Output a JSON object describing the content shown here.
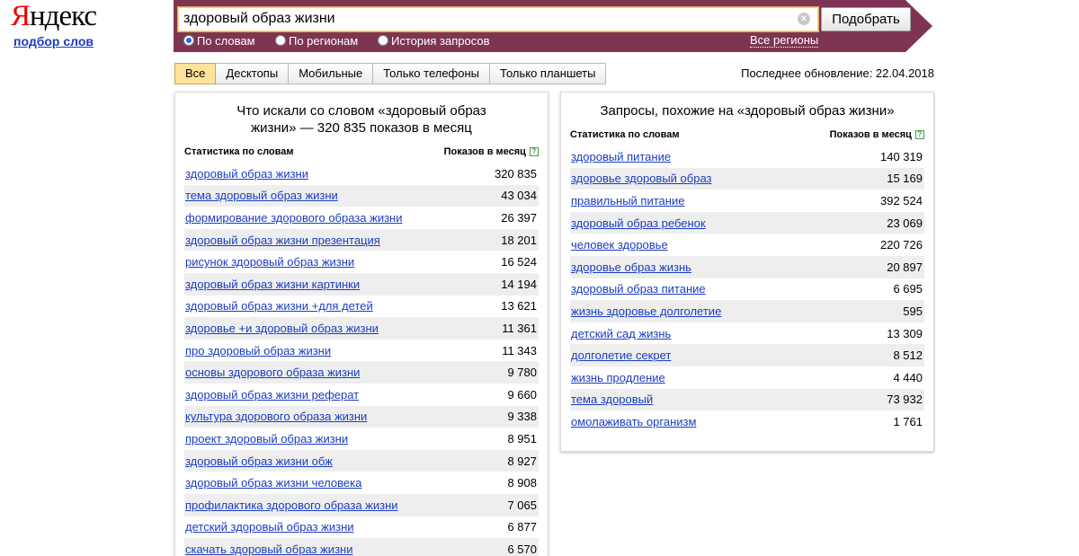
{
  "logo": {
    "brand_first": "Я",
    "brand_rest": "ндекс",
    "subtitle": "подбор слов"
  },
  "search": {
    "value": "здоровый образ жизни",
    "clear_icon": "×",
    "submit_label": "Подобрать"
  },
  "modes": [
    {
      "label": "По словам",
      "selected": true
    },
    {
      "label": "По регионам",
      "selected": false
    },
    {
      "label": "История запросов",
      "selected": false
    }
  ],
  "regions_link": "Все регионы",
  "device_tabs": [
    "Все",
    "Десктопы",
    "Мобильные",
    "Только телефоны",
    "Только планшеты"
  ],
  "last_update": "Последнее обновление: 22.04.2018",
  "left_panel": {
    "title": "Что искали со словом «здоровый образ жизни» — 320 835 показов в месяц",
    "col_phrase": "Статистика по словам",
    "col_count": "Показов в месяц",
    "help_icon": "?",
    "rows": [
      {
        "phrase": "здоровый образ жизни",
        "count": "320 835"
      },
      {
        "phrase": "тема здоровый образ жизни",
        "count": "43 034"
      },
      {
        "phrase": "формирование здорового образа жизни",
        "count": "26 397"
      },
      {
        "phrase": "здоровый образ жизни презентация",
        "count": "18 201"
      },
      {
        "phrase": "рисунок здоровый образ жизни",
        "count": "16 524"
      },
      {
        "phrase": "здоровый образ жизни картинки",
        "count": "14 194"
      },
      {
        "phrase": "здоровый образ жизни +для детей",
        "count": "13 621"
      },
      {
        "phrase": "здоровье +и здоровый образ жизни",
        "count": "11 361"
      },
      {
        "phrase": "про здоровый образ жизни",
        "count": "11 343"
      },
      {
        "phrase": "основы здорового образа жизни",
        "count": "9 780"
      },
      {
        "phrase": "здоровый образ жизни реферат",
        "count": "9 660"
      },
      {
        "phrase": "культура здорового образа жизни",
        "count": "9 338"
      },
      {
        "phrase": "проект здоровый образ жизни",
        "count": "8 951"
      },
      {
        "phrase": "здоровый образ жизни обж",
        "count": "8 927"
      },
      {
        "phrase": "здоровый образ жизни человека",
        "count": "8 908"
      },
      {
        "phrase": "профилактика здорового образа жизни",
        "count": "7 065"
      },
      {
        "phrase": "детский здоровый образ жизни",
        "count": "6 877"
      },
      {
        "phrase": "скачать здоровый образ жизни",
        "count": "6 570"
      }
    ]
  },
  "right_panel": {
    "title": "Запросы, похожие на «здоровый образ жизни»",
    "col_phrase": "Статистика по словам",
    "col_count": "Показов в месяц",
    "help_icon": "?",
    "rows": [
      {
        "phrase": "здоровый питание",
        "count": "140 319"
      },
      {
        "phrase": "здоровье здоровый образ",
        "count": "15 169"
      },
      {
        "phrase": "правильный питание",
        "count": "392 524"
      },
      {
        "phrase": "здоровый образ ребенок",
        "count": "23 069"
      },
      {
        "phrase": "человек здоровье",
        "count": "220 726"
      },
      {
        "phrase": "здоровье образ жизнь",
        "count": "20 897"
      },
      {
        "phrase": "здоровый образ питание",
        "count": "6 695"
      },
      {
        "phrase": "жизнь здоровье долголетие",
        "count": "595"
      },
      {
        "phrase": "детский сад жизнь",
        "count": "13 309"
      },
      {
        "phrase": "долголетие секрет",
        "count": "8 512"
      },
      {
        "phrase": "жизнь продление",
        "count": "4 440"
      },
      {
        "phrase": "тема здоровый",
        "count": "73 932"
      },
      {
        "phrase": "омолаживать организм",
        "count": "1 761"
      }
    ]
  },
  "colors": {
    "header_bg": "#7e3553",
    "link": "#1a3dc1",
    "active_tab": "#ffe39a",
    "logo_red": "#e00000"
  }
}
